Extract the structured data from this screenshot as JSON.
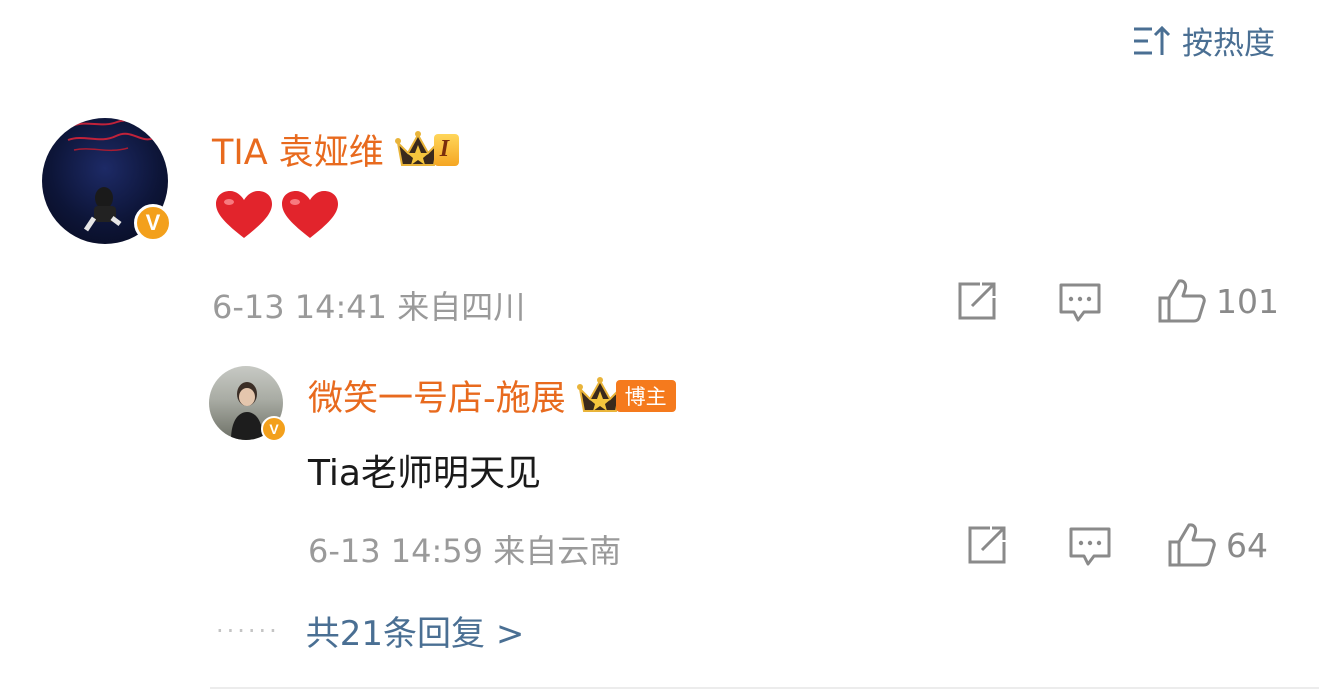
{
  "sort": {
    "label": "按热度",
    "icon": "sort-icon"
  },
  "comment": {
    "username": "TIA 袁娅维",
    "rank_badge": "I",
    "meta": "6-13 14:41 来自四川",
    "emoji": [
      "heart",
      "heart"
    ],
    "likes": "101"
  },
  "reply": {
    "username": "微笑一号店-施展",
    "host_badge": "博主",
    "content": "Tia老师明天见",
    "meta": "6-13 14:59 来自云南",
    "likes": "64"
  },
  "more": {
    "dots": "······",
    "label": "共21条回复 >"
  },
  "colors": {
    "username": "#e86a1e",
    "link": "#4a6f93",
    "meta": "#9a9a9a",
    "verified": "#f3a01c"
  }
}
